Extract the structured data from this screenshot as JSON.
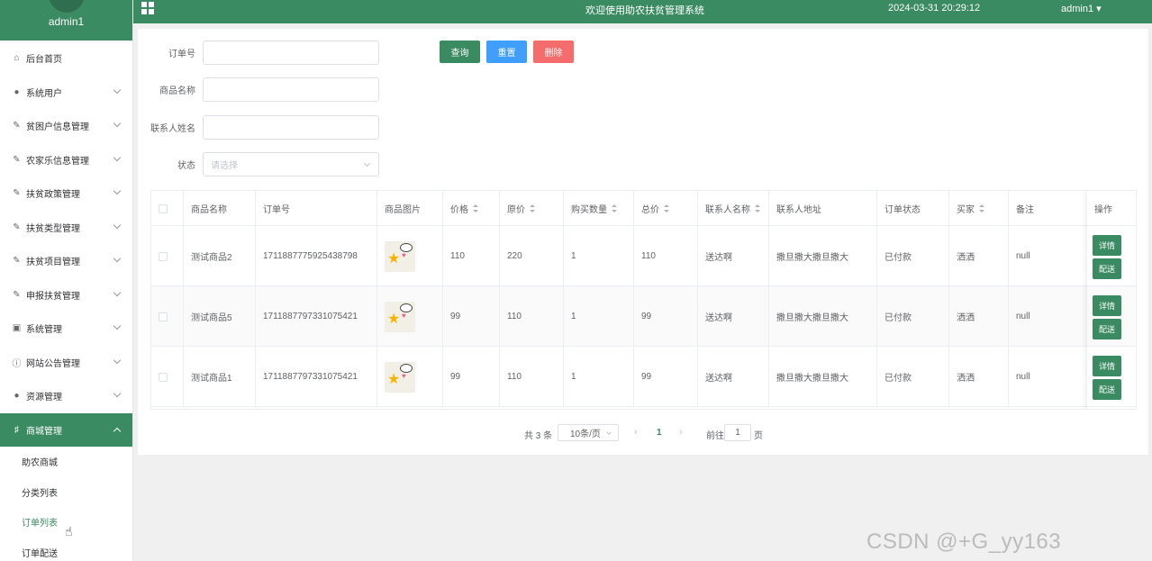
{
  "app": {
    "title": "欢迎使用助农扶贫管理系统",
    "datetime": "2024-03-31 20:29:12",
    "user_menu": "admin1 ▾",
    "accent_color": "#3a8a62"
  },
  "sidebar": {
    "username": "admin1",
    "items": [
      {
        "label": "后台首页",
        "icon": "home-icon"
      },
      {
        "label": "系统用户",
        "icon": "user-icon"
      },
      {
        "label": "贫困户信息管理",
        "icon": "edit-icon"
      },
      {
        "label": "农家乐信息管理",
        "icon": "edit-icon"
      },
      {
        "label": "扶贫政策管理",
        "icon": "edit-icon"
      },
      {
        "label": "扶贫类型管理",
        "icon": "edit-icon"
      },
      {
        "label": "扶贫项目管理",
        "icon": "edit-icon"
      },
      {
        "label": "申报扶贫管理",
        "icon": "edit-icon"
      },
      {
        "label": "系统管理",
        "icon": "picture-icon"
      },
      {
        "label": "网站公告管理",
        "icon": "info-icon"
      },
      {
        "label": "资源管理",
        "icon": "location-icon"
      },
      {
        "label": "商城管理",
        "icon": "cart-icon"
      }
    ],
    "sub_items": [
      {
        "label": "助农商城"
      },
      {
        "label": "分类列表"
      },
      {
        "label": "订单列表"
      },
      {
        "label": "订单配送"
      }
    ]
  },
  "search": {
    "order_no_label": "订单号",
    "order_no_value": "",
    "product_name_label": "商品名称",
    "product_name_value": "",
    "contact_name_label": "联系人姓名",
    "contact_name_value": "",
    "status_label": "状态",
    "status_placeholder": "请选择",
    "query_button": "查询",
    "reset_button": "重置",
    "delete_button": "删除"
  },
  "table": {
    "headers": [
      "商品名称",
      "订单号",
      "商品图片",
      "价格",
      "原价",
      "购买数量",
      "总价",
      "联系人名称",
      "联系人地址",
      "订单状态",
      "买家",
      "备注",
      "操作"
    ],
    "rows": [
      {
        "product_name": "测试商品2",
        "order_no": "1711887775925438798",
        "price": "110",
        "original_price": "220",
        "quantity": "1",
        "total": "110",
        "contact_name": "送达啊",
        "contact_address": "撒旦撒大撒旦撒大",
        "status": "已付款",
        "buyer": "洒洒",
        "remark": "null"
      },
      {
        "product_name": "测试商品5",
        "order_no": "1711887797331075421",
        "price": "99",
        "original_price": "110",
        "quantity": "1",
        "total": "99",
        "contact_name": "送达啊",
        "contact_address": "撒旦撒大撒旦撒大",
        "status": "已付款",
        "buyer": "洒洒",
        "remark": "null"
      },
      {
        "product_name": "测试商品1",
        "order_no": "1711887797331075421",
        "price": "99",
        "original_price": "110",
        "quantity": "1",
        "total": "99",
        "contact_name": "送达啊",
        "contact_address": "撒旦撒大撒旦撒大",
        "status": "已付款",
        "buyer": "洒洒",
        "remark": "null"
      }
    ],
    "detail_button": "详情",
    "deliver_button": "配送"
  },
  "pagination": {
    "total_text": "共 3 条",
    "page_size": "10条/页",
    "current_page": "1",
    "goto_label": "前往",
    "goto_value": "1",
    "page_suffix": "页"
  },
  "watermark": "CSDN @+G_yy163"
}
